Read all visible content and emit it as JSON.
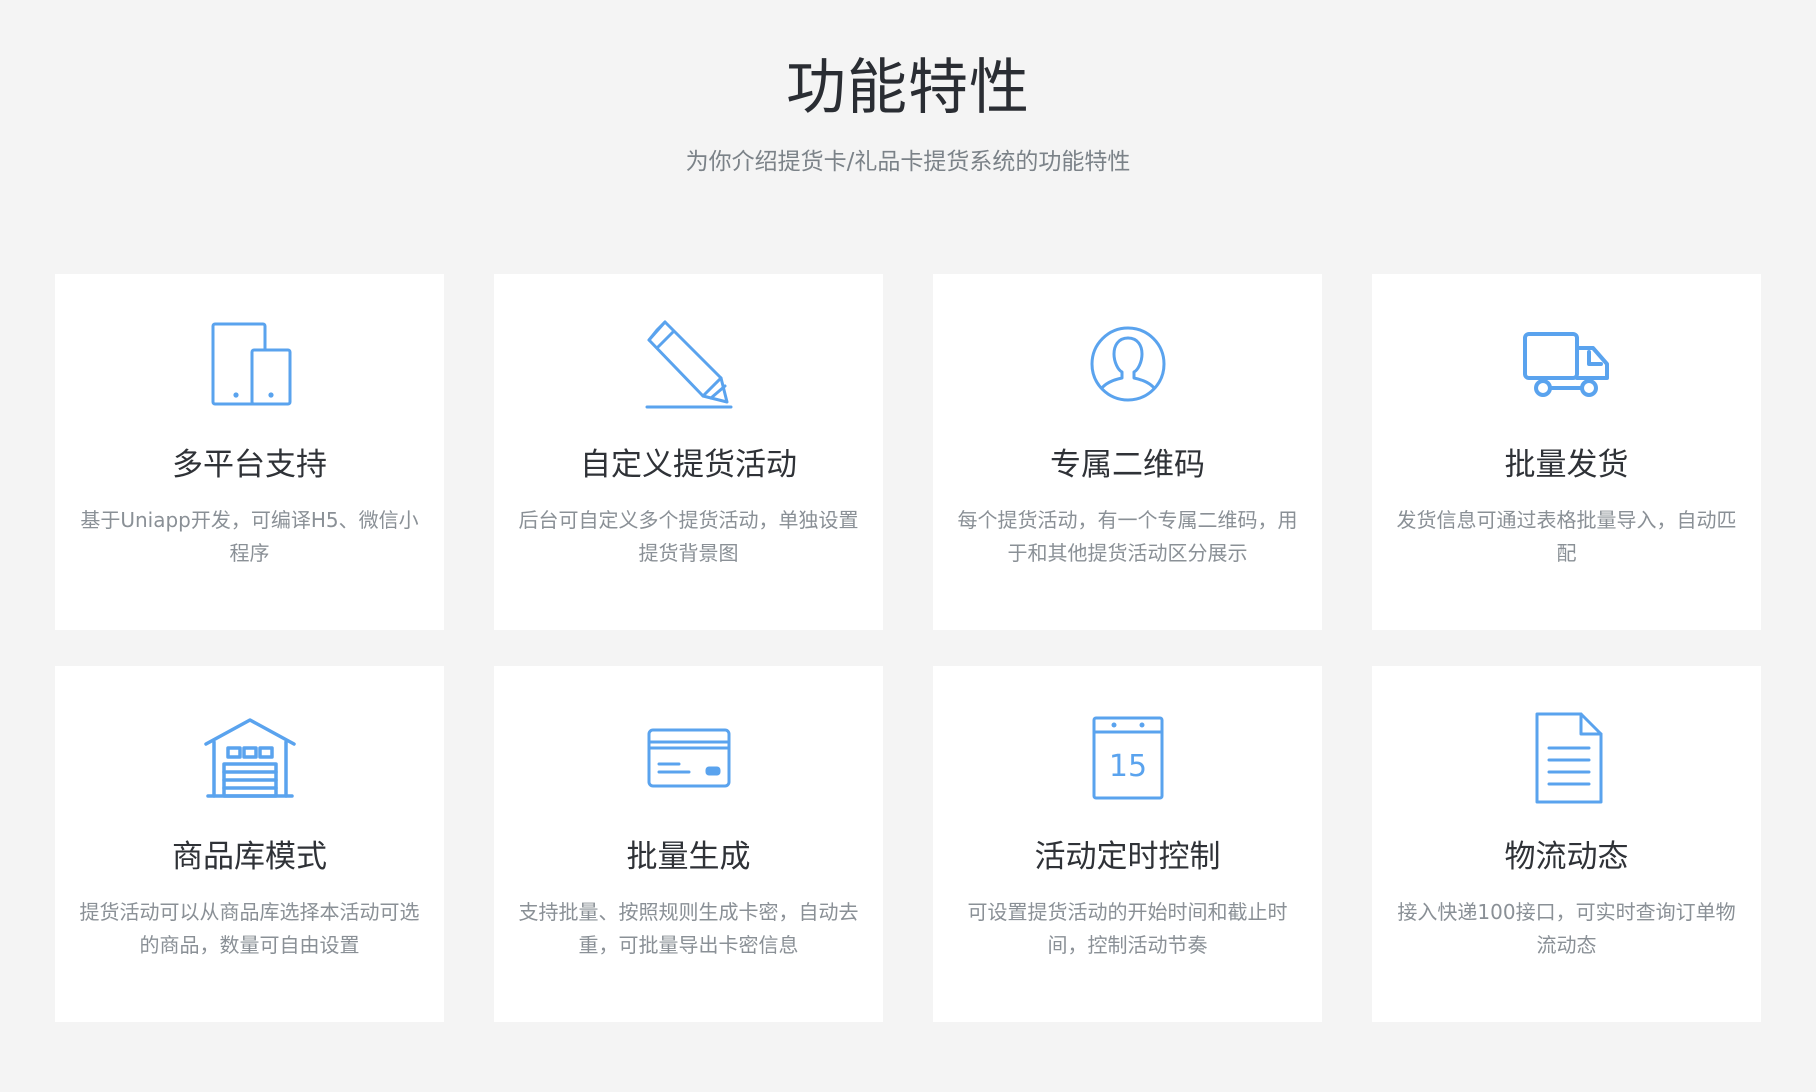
{
  "header": {
    "title": "功能特性",
    "subtitle": "为你介绍提货卡/礼品卡提货系统的功能特性"
  },
  "theme": {
    "accent": "#5aa3ee",
    "background": "#f4f4f4",
    "card": "#ffffff"
  },
  "features": [
    {
      "icon": "devices-icon",
      "title": "多平台支持",
      "desc": "基于Uniapp开发，可编译H5、微信小程序"
    },
    {
      "icon": "pencil-icon",
      "title": "自定义提货活动",
      "desc": "后台可自定义多个提货活动，单独设置提货背景图"
    },
    {
      "icon": "user-icon",
      "title": "专属二维码",
      "desc": "每个提货活动，有一个专属二维码，用于和其他提货活动区分展示"
    },
    {
      "icon": "truck-icon",
      "title": "批量发货",
      "desc": "发货信息可通过表格批量导入，自动匹配"
    },
    {
      "icon": "warehouse-icon",
      "title": "商品库模式",
      "desc": "提货活动可以从商品库选择本活动可选的商品，数量可自由设置"
    },
    {
      "icon": "card-icon",
      "title": "批量生成",
      "desc": "支持批量、按照规则生成卡密，自动去重，可批量导出卡密信息"
    },
    {
      "icon": "calendar-icon",
      "title": "活动定时控制",
      "desc": "可设置提货活动的开始时间和截止时间，控制活动节奏",
      "icon_text": "15"
    },
    {
      "icon": "document-icon",
      "title": "物流动态",
      "desc": "接入快递100接口，可实时查询订单物流动态"
    }
  ]
}
